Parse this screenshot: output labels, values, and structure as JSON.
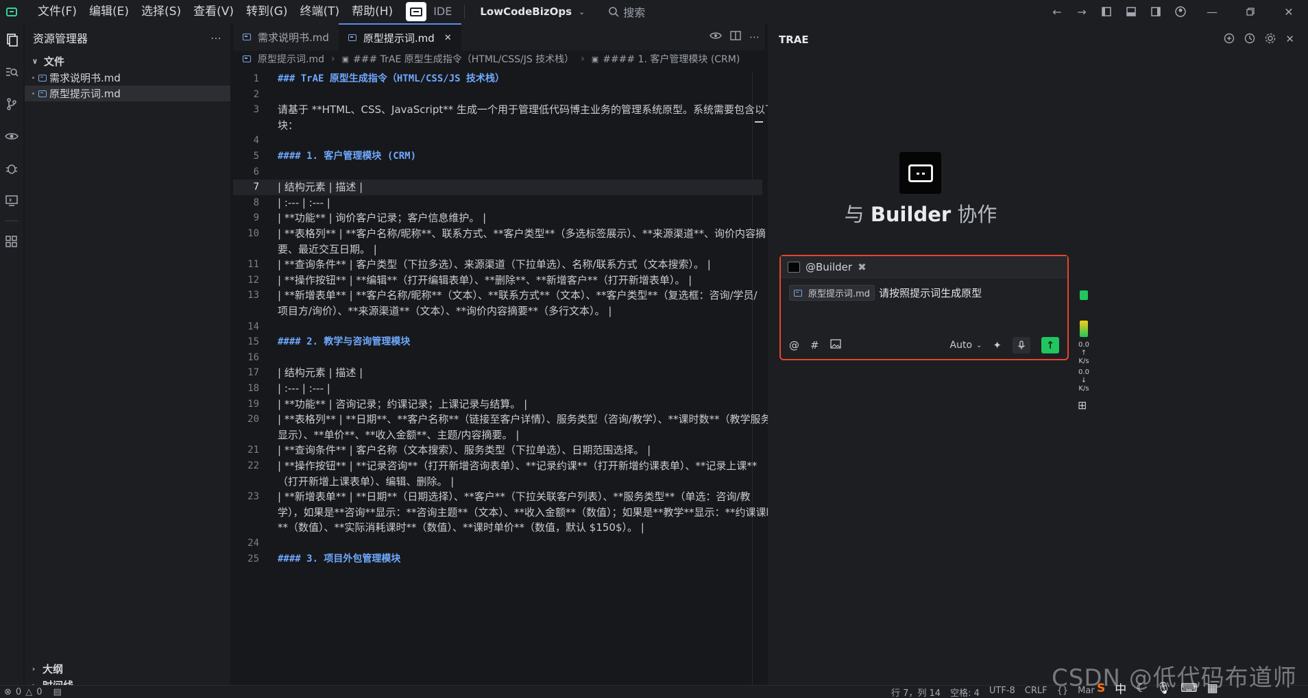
{
  "titlebar": {
    "menus": [
      "文件(F)",
      "编辑(E)",
      "选择(S)",
      "查看(V)",
      "转到(G)",
      "终端(T)",
      "帮助(H)"
    ],
    "mode": "IDE",
    "project": "LowCodeBizOps",
    "search_placeholder": "搜索"
  },
  "explorer": {
    "title": "资源管理器",
    "folder": "文件",
    "files": [
      "需求说明书.md",
      "原型提示词.md"
    ],
    "outline": "大纲",
    "timeline": "时间线"
  },
  "editor": {
    "tabs": [
      "需求说明书.md",
      "原型提示词.md"
    ],
    "breadcrumb": [
      "原型提示词.md",
      "### TrAE 原型生成指令（HTML/CSS/JS 技术栈）",
      "#### 1. 客户管理模块 (CRM)"
    ],
    "current_line": 7,
    "lines": [
      {
        "n": "1",
        "t": "### TrAE 原型生成指令（HTML/CSS/JS 技术栈）",
        "h": true
      },
      {
        "n": "2",
        "t": ""
      },
      {
        "n": "3",
        "t": "请基于 **HTML、CSS、JavaScript** 生成一个用于管理低代码博主业务的管理系统原型。系统需要包含以下模"
      },
      {
        "n": "",
        "t": "块："
      },
      {
        "n": "4",
        "t": ""
      },
      {
        "n": "5",
        "t": "#### 1. 客户管理模块 (CRM)",
        "h": true
      },
      {
        "n": "6",
        "t": ""
      },
      {
        "n": "7",
        "t": "| 结构元素 | 描述 |"
      },
      {
        "n": "8",
        "t": "| :--- | :--- |"
      },
      {
        "n": "9",
        "t": "| **功能** | 询价客户记录；客户信息维护。 |"
      },
      {
        "n": "10",
        "t": "| **表格列** | **客户名称/昵称**、联系方式、**客户类型**（多选标签展示）、**来源渠道**、询价内容摘"
      },
      {
        "n": "",
        "t": "要、最近交互日期。 |"
      },
      {
        "n": "11",
        "t": "| **查询条件** | 客户类型（下拉多选）、来源渠道（下拉单选）、名称/联系方式（文本搜索）。 |"
      },
      {
        "n": "12",
        "t": "| **操作按钮** | **编辑**（打开编辑表单）、**删除**、**新增客户**（打开新增表单）。 |"
      },
      {
        "n": "13",
        "t": "| **新增表单** | **客户名称/昵称**（文本）、**联系方式**（文本）、**客户类型**（复选框：咨询/学员/"
      },
      {
        "n": "",
        "t": "项目方/询价）、**来源渠道**（文本）、**询价内容摘要**（多行文本）。 |"
      },
      {
        "n": "14",
        "t": ""
      },
      {
        "n": "15",
        "t": "#### 2. 教学与咨询管理模块",
        "h": true
      },
      {
        "n": "16",
        "t": ""
      },
      {
        "n": "17",
        "t": "| 结构元素 | 描述 |"
      },
      {
        "n": "18",
        "t": "| :--- | :--- |"
      },
      {
        "n": "19",
        "t": "| **功能** | 咨询记录；约课记录；上课记录与结算。 |"
      },
      {
        "n": "20",
        "t": "| **表格列** | **日期**、**客户名称**（链接至客户详情）、服务类型（咨询/教学）、**课时数**（教学服务"
      },
      {
        "n": "",
        "t": "显示）、**单价**、**收入金额**、主题/内容摘要。 |"
      },
      {
        "n": "21",
        "t": "| **查询条件** | 客户名称（文本搜索）、服务类型（下拉单选）、日期范围选择。 |"
      },
      {
        "n": "22",
        "t": "| **操作按钮** | **记录咨询**（打开新增咨询表单）、**记录约课**（打开新增约课表单）、**记录上课**"
      },
      {
        "n": "",
        "t": "（打开新增上课表单）、编辑、删除。 |"
      },
      {
        "n": "23",
        "t": "| **新增表单** | **日期**（日期选择）、**客户**（下拉关联客户列表）、**服务类型**（单选：咨询/教"
      },
      {
        "n": "",
        "t": "学），如果是**咨询**显示：**咨询主题**（文本）、**收入金额**（数值）；如果是**教学**显示：**约课课时"
      },
      {
        "n": "",
        "t": "**（数值）、**实际消耗课时**（数值）、**课时单价**（数值，默认 $150$）。 |"
      },
      {
        "n": "24",
        "t": ""
      },
      {
        "n": "25",
        "t": "#### 3. 项目外包管理模块",
        "h": true
      }
    ]
  },
  "chat": {
    "title": "TRAE",
    "hero_prefix": "与",
    "hero_bold": "Builder",
    "hero_suffix": "协作",
    "agent": "@Builder",
    "attachment": "原型提示词.md",
    "message": "请按照提示词生成原型",
    "mode": "Auto",
    "net_up": "0.0",
    "net_down": "0.0",
    "net_unit": "K/s"
  },
  "status": {
    "errors": "0",
    "warnings": "0",
    "position": "行 7，列 14",
    "spaces": "空格: 4",
    "encoding": "UTF-8",
    "eol": "CRLF",
    "braces": "{}",
    "lang": "Mar"
  },
  "watermark": "CSDN @低代码布道师",
  "tray": {
    "ime": "S",
    "lang": "中"
  }
}
